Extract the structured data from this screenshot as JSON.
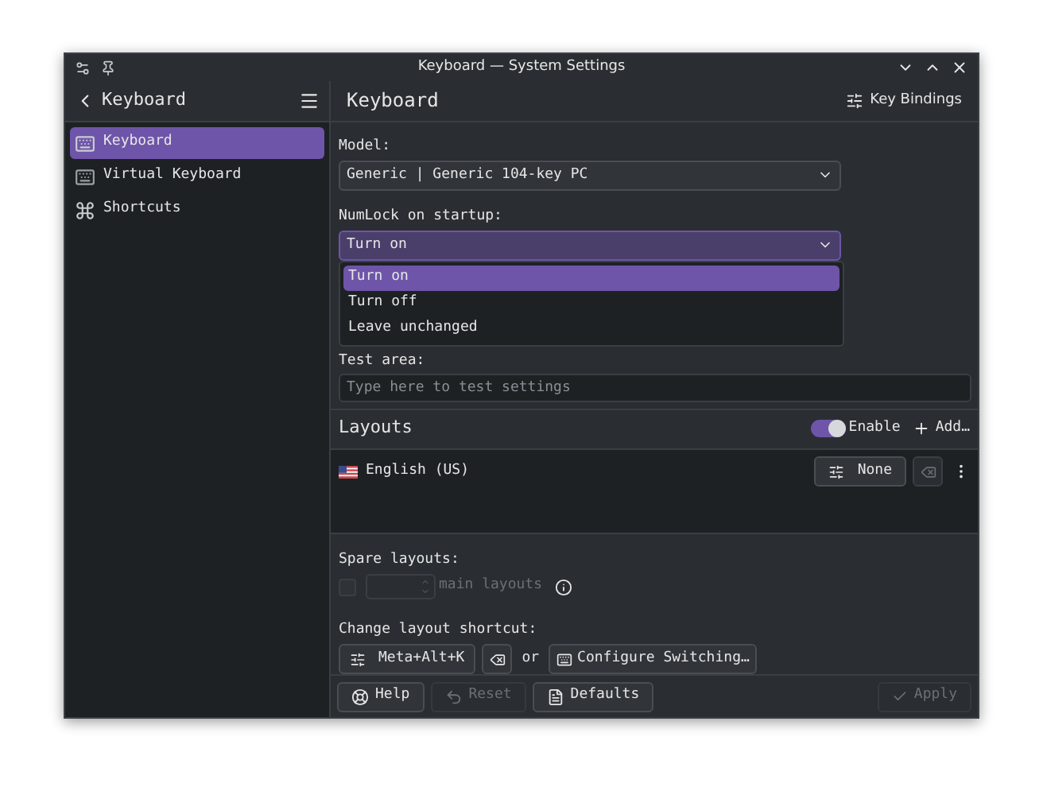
{
  "window": {
    "title": "Keyboard — System Settings"
  },
  "sidebar": {
    "title": "Keyboard",
    "items": [
      {
        "label": "Keyboard",
        "selected": true,
        "kind": "keyboard"
      },
      {
        "label": "Virtual Keyboard",
        "selected": false,
        "kind": "virtual"
      },
      {
        "label": "Shortcuts",
        "selected": false,
        "kind": "shortcut"
      }
    ]
  },
  "page": {
    "title": "Keyboard",
    "header_button": "Key Bindings"
  },
  "model": {
    "label": "Model:",
    "value": "Generic | Generic 104-key PC"
  },
  "numlock": {
    "label": "NumLock on startup:",
    "value": "Turn on",
    "expanded": true,
    "options": [
      {
        "label": "Turn on",
        "selected": true
      },
      {
        "label": "Turn off",
        "selected": false
      },
      {
        "label": "Leave unchanged",
        "selected": false
      }
    ]
  },
  "test_area": {
    "label": "Test area:",
    "placeholder": "Type here to test settings"
  },
  "layouts": {
    "title": "Layouts",
    "enable": {
      "label": "Enable",
      "on": true
    },
    "add_button": "Add…",
    "items": [
      {
        "name": "English (US)",
        "shortcut": "None"
      }
    ]
  },
  "spare_layouts": {
    "label": "Spare layouts:",
    "checked": false,
    "disabled": true,
    "suffix": "main layouts"
  },
  "change_shortcut": {
    "label": "Change layout shortcut:",
    "shortcut": "Meta+Alt+K",
    "or": "or",
    "configure_button": "Configure Switching…"
  },
  "footer": {
    "buttons": [
      {
        "label": "Help",
        "disabled": false,
        "kind": "help"
      },
      {
        "label": "Reset",
        "disabled": true,
        "kind": "reset"
      },
      {
        "label": "Defaults",
        "disabled": false,
        "kind": "defaults"
      }
    ],
    "apply": {
      "label": "Apply",
      "disabled": true
    }
  }
}
